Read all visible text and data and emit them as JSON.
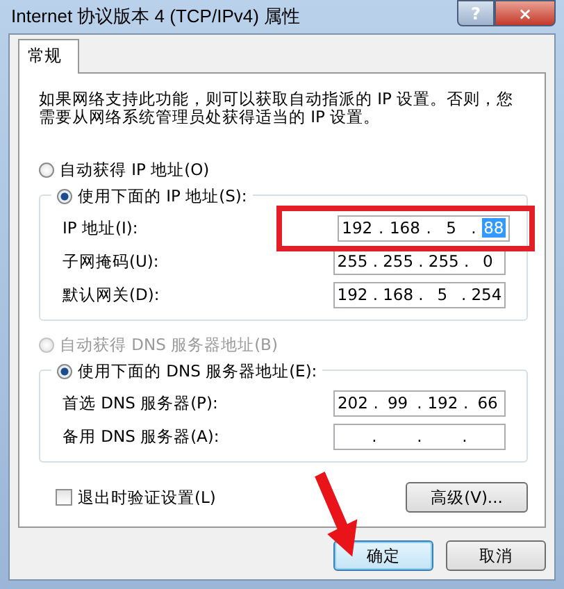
{
  "window": {
    "title": "Internet 协议版本 4 (TCP/IPv4) 属性",
    "help": "?",
    "close": "×"
  },
  "tabs": [
    {
      "label": "常规",
      "selected": true
    }
  ],
  "description": "如果网络支持此功能，则可以获取自动指派的 IP 设置。否则，您需要从网络系统管理员处获得适当的 IP 设置。",
  "octet_separator": ".",
  "ip_mode": [
    {
      "label": "自动获得 IP 地址(O)",
      "selected": false,
      "disabled": false
    },
    {
      "label": "使用下面的 IP 地址(S):",
      "selected": true,
      "disabled": false
    }
  ],
  "ip_fields": [
    {
      "label": "IP 地址(I):",
      "highlighted": true,
      "octets": [
        {
          "value": "192",
          "selected": false
        },
        {
          "value": "168",
          "selected": false
        },
        {
          "value": "5",
          "selected": false
        },
        {
          "value": "88",
          "selected": true
        }
      ]
    },
    {
      "label": "子网掩码(U):",
      "highlighted": false,
      "octets": [
        {
          "value": "255",
          "selected": false
        },
        {
          "value": "255",
          "selected": false
        },
        {
          "value": "255",
          "selected": false
        },
        {
          "value": "0",
          "selected": false
        }
      ]
    },
    {
      "label": "默认网关(D):",
      "highlighted": false,
      "octets": [
        {
          "value": "192",
          "selected": false
        },
        {
          "value": "168",
          "selected": false
        },
        {
          "value": "5",
          "selected": false
        },
        {
          "value": "254",
          "selected": false
        }
      ]
    }
  ],
  "dns_mode": [
    {
      "label": "自动获得 DNS 服务器地址(B)",
      "selected": false,
      "disabled": true
    },
    {
      "label": "使用下面的 DNS 服务器地址(E):",
      "selected": true,
      "disabled": false
    }
  ],
  "dns_fields": [
    {
      "label": "首选 DNS 服务器(P):",
      "highlighted": false,
      "octets": [
        {
          "value": "202",
          "selected": false
        },
        {
          "value": "99",
          "selected": false
        },
        {
          "value": "192",
          "selected": false
        },
        {
          "value": "66",
          "selected": false
        }
      ]
    },
    {
      "label": "备用 DNS 服务器(A):",
      "highlighted": false
    }
  ],
  "validate": {
    "label": "退出时验证设置(L)",
    "checked": false
  },
  "advanced_button": "高级(V)...",
  "buttons": [
    {
      "label": "确定",
      "default": true
    },
    {
      "label": "取消",
      "default": false
    }
  ]
}
